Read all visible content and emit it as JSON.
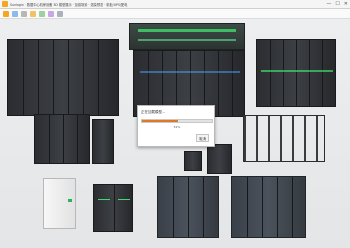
{
  "window": {
    "title": "Sunlogin · 数据中心机房设备 3D 模型展示 · 加载场景 · 渲染预览 · 机柜/UPS/配电",
    "controls": {
      "minimize": "—",
      "maximize": "☐",
      "close": "✕"
    }
  },
  "toolbar": {
    "icons": [
      "app-logo-icon",
      "refresh-icon",
      "save-icon",
      "layers-icon",
      "rotate-icon",
      "camera-icon",
      "grid-icon"
    ]
  },
  "dialog": {
    "title": "正在加载模型...",
    "progress_fraction": 0.52,
    "progress_text": "52%",
    "button_label": "取消"
  },
  "colors": {
    "accent": "#e07a21",
    "rack_dark": "#2e3034",
    "led_green": "#3ddc6a",
    "led_blue": "#4aa3ff",
    "panel_white": "#f2f2f2"
  }
}
